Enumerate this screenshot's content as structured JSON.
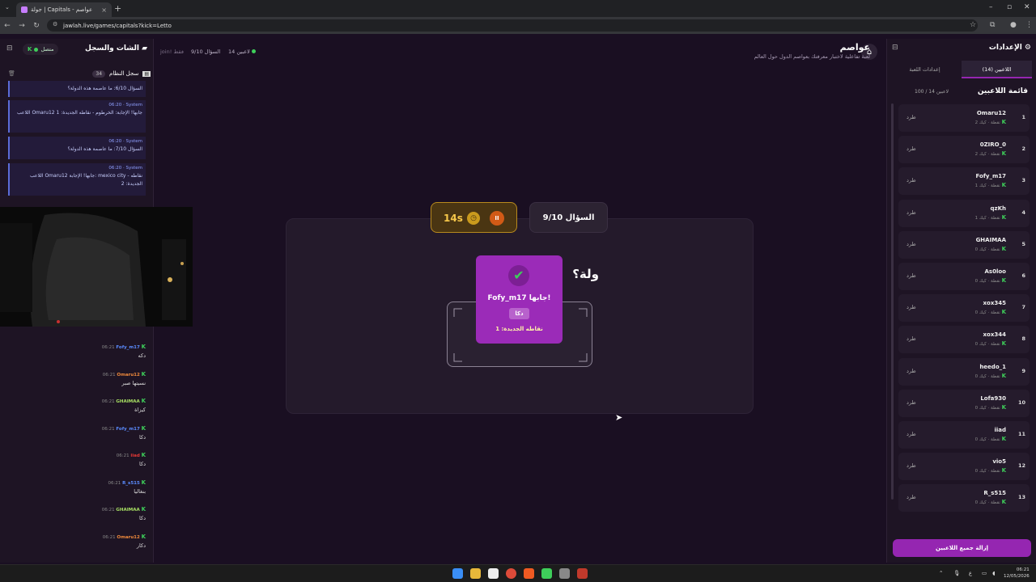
{
  "browser": {
    "tab_title": "جولة | Capitals - عواصم",
    "url": "jawlah.live/games/capitals?kick=Letto"
  },
  "chat_panel": {
    "title": "الشات والسجل",
    "online_label": "متصل",
    "system_log_label": "سجل النظام",
    "system_log_count": "34",
    "system_messages": [
      {
        "time": "",
        "sender": "",
        "text": "السؤال 6/10: ما عاصمة هذه الدولة؟"
      },
      {
        "time": "06:20",
        "sender": "System",
        "text": "اللاعب Omaru12 جابها! الإجابة: الخرطوم - نقاطه الجديدة: 1"
      },
      {
        "time": "06:20",
        "sender": "System",
        "text": "السؤال 7/10: ما عاصمة هذه الدولة؟"
      },
      {
        "time": "06:20",
        "sender": "System",
        "text": "اللاعب Omaru12 جابها! الإجابة: mexico city - نقاطه الجديدة: 2"
      }
    ],
    "chat_messages": [
      {
        "time": "06:21",
        "user": "Fofy_m17",
        "color": "#5b8cff",
        "text": "دكه"
      },
      {
        "time": "06:21",
        "user": "Omaru12",
        "color": "#f08a3c",
        "text": "نسيتها صبر"
      },
      {
        "time": "06:21",
        "user": "GHAIMAA",
        "color": "#a8e063",
        "text": "كيزاة"
      },
      {
        "time": "06:21",
        "user": "Fofy_m17",
        "color": "#5b8cff",
        "text": "دكا"
      },
      {
        "time": "06:21",
        "user": "iiad",
        "color": "#e53935",
        "text": "دكا"
      },
      {
        "time": "06:21",
        "user": "R_s515",
        "color": "#5b8cff",
        "text": "بنغاليا"
      },
      {
        "time": "06:21",
        "user": "GHAIMAA",
        "color": "#a8e063",
        "text": "دكا"
      },
      {
        "time": "06:21",
        "user": "Omaru12",
        "color": "#f08a3c",
        "text": "دكار"
      }
    ]
  },
  "header": {
    "title": "عواصم",
    "subtitle": "لعبة تفاعلية لاختبار معرفتك بعواصم الدول حول العالم",
    "players_stat": "14 لاعبين",
    "question_stat": "السؤال 9/10",
    "join_stat": "join! فقط"
  },
  "game": {
    "question_counter": "السؤال 9/10",
    "timer": "14s",
    "question_start": "وش",
    "question_end": "ولة؟",
    "popup": {
      "winner": "Fofy_m17 جابها!",
      "answer": "دكا",
      "points": "نقاطه الجديدة: 1"
    }
  },
  "settings": {
    "title": "الإعدادات",
    "tab_players": "اللاعبين (14)",
    "tab_game_settings": "إعدادات اللعبة",
    "players_header": "قائمة اللاعبين",
    "players_count": "100 / 14 لاعبين",
    "kick_label": "طرد",
    "remove_all": "إزالة جميع اللاعبين",
    "players": [
      {
        "rank": "1",
        "name": "Omaru12",
        "sub": "2 نقطة · كيك"
      },
      {
        "rank": "2",
        "name": "0ZIRO_0",
        "sub": "2 نقطة · كيك"
      },
      {
        "rank": "3",
        "name": "Fofy_m17",
        "sub": "1 نقطة · كيك"
      },
      {
        "rank": "4",
        "name": "qzKh",
        "sub": "1 نقطة · كيك"
      },
      {
        "rank": "5",
        "name": "GHAIMAA",
        "sub": "0 نقطة · كيك"
      },
      {
        "rank": "6",
        "name": "As0loo",
        "sub": "0 نقطة · كيك"
      },
      {
        "rank": "7",
        "name": "xox345",
        "sub": "0 نقطة · كيك"
      },
      {
        "rank": "8",
        "name": "xox344",
        "sub": "0 نقطة · كيك"
      },
      {
        "rank": "9",
        "name": "heedo_1",
        "sub": "0 نقطة · كيك"
      },
      {
        "rank": "10",
        "name": "Lofa930",
        "sub": "0 نقطة · كيك"
      },
      {
        "rank": "11",
        "name": "iiad",
        "sub": "0 نقطة · كيك"
      },
      {
        "rank": "12",
        "name": "vio5",
        "sub": "0 نقطة · كيك"
      },
      {
        "rank": "13",
        "name": "R_s515",
        "sub": "0 نقطة · كيك"
      }
    ]
  },
  "taskbar": {
    "time": "06:21",
    "date": "12/05/2026",
    "lang": "ع"
  }
}
